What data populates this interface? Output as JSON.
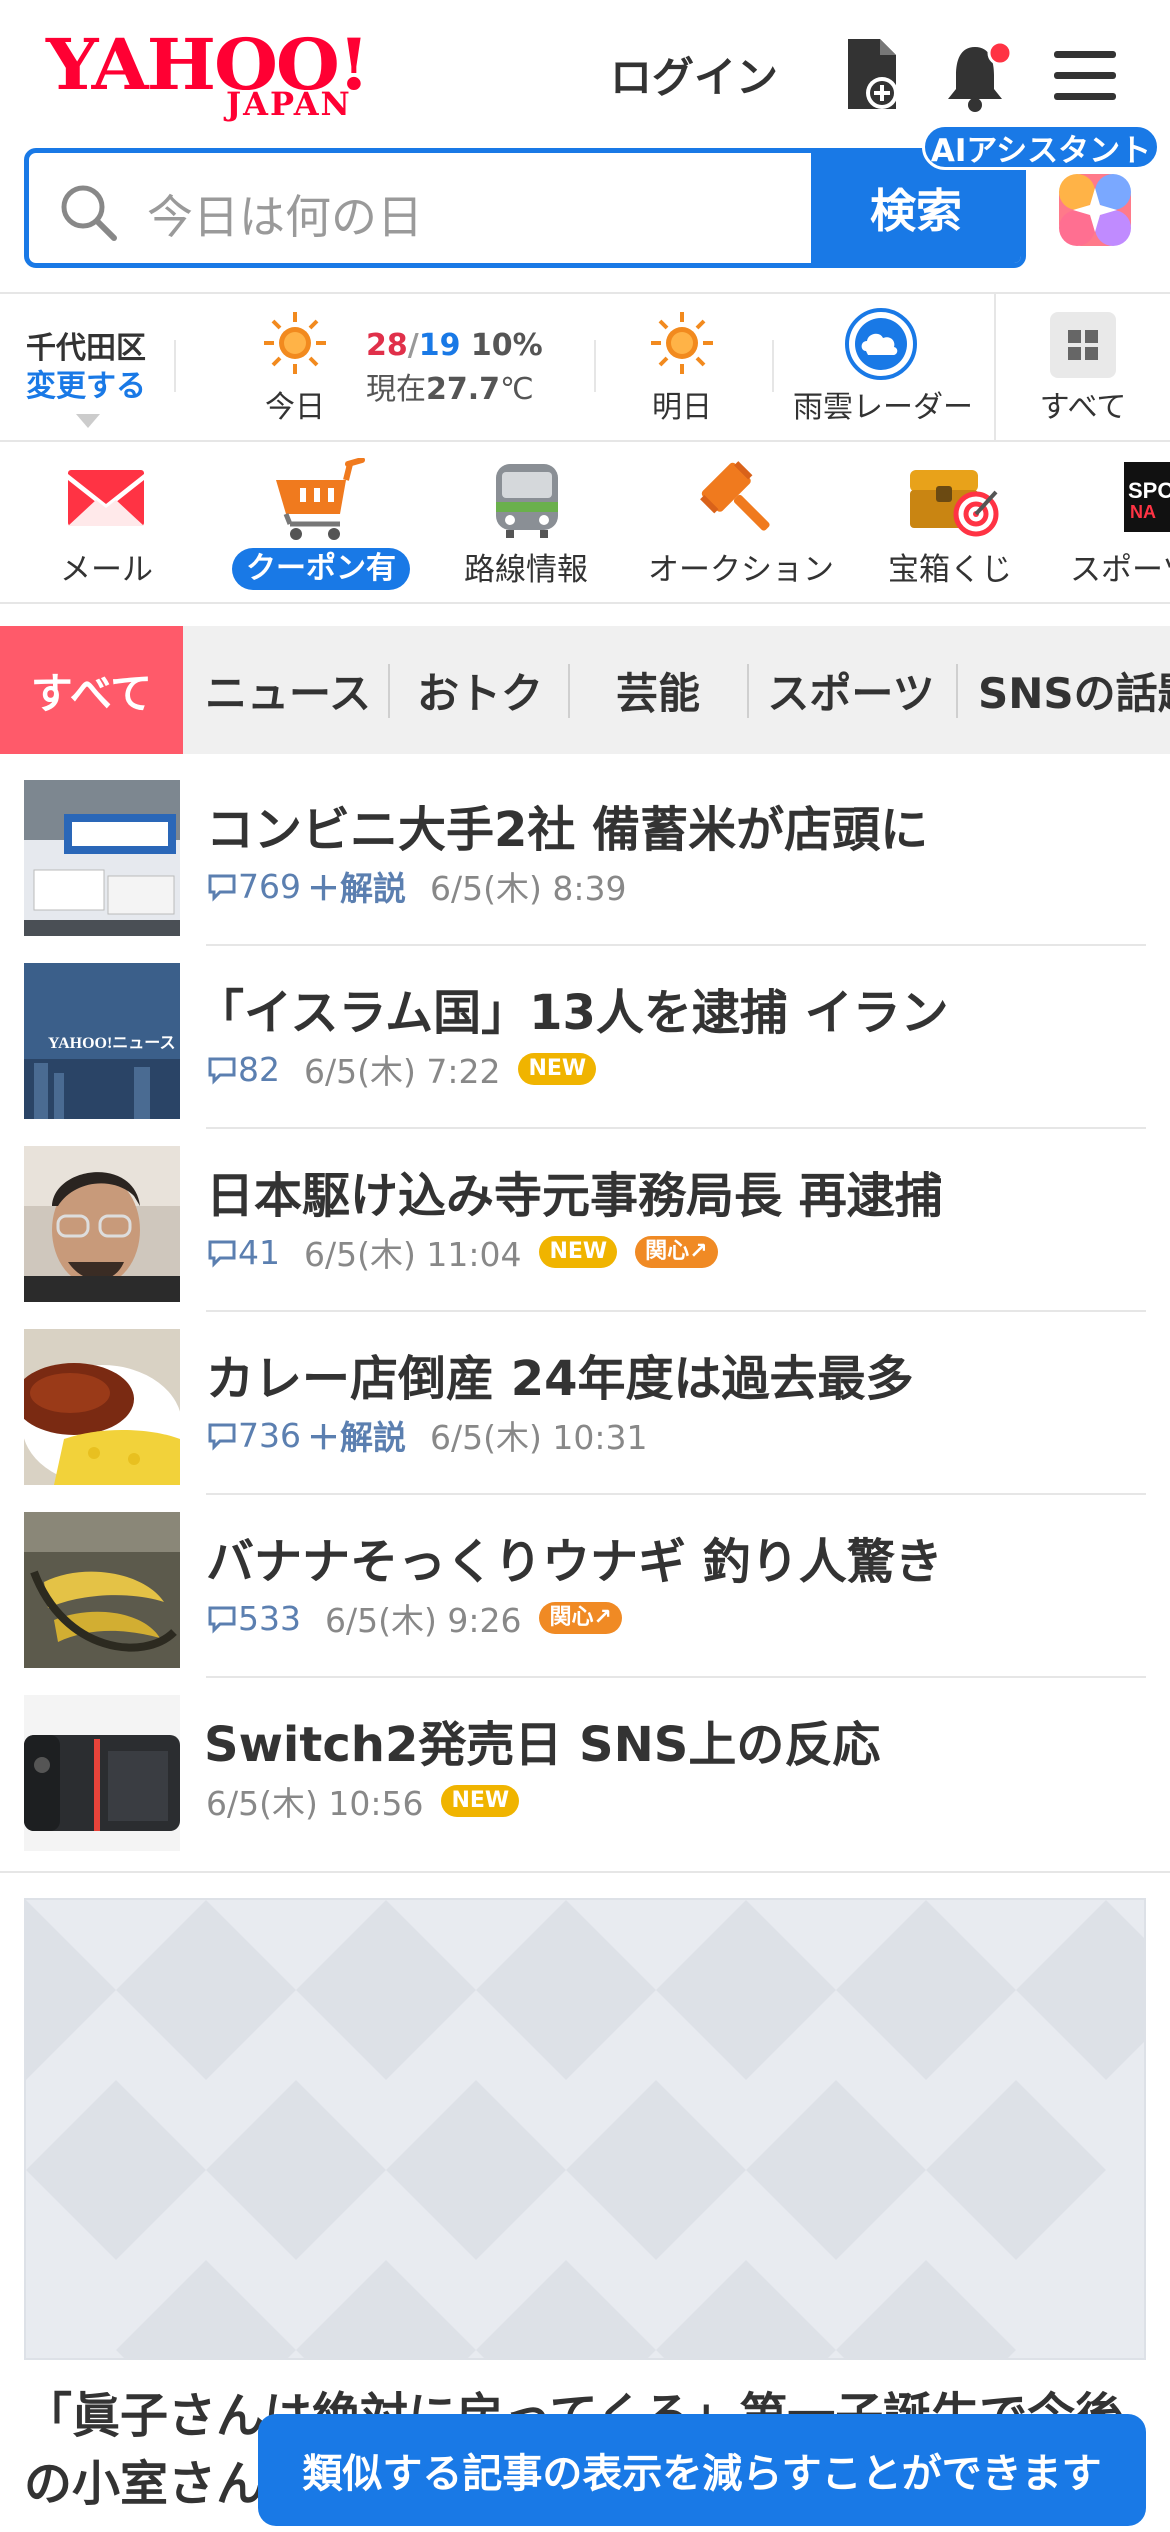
{
  "header": {
    "logo_text": "YAHOO!",
    "logo_sub": "JAPAN",
    "login_label": "ログイン",
    "icons": [
      "add-document-icon",
      "bell-icon",
      "hamburger-menu-icon"
    ]
  },
  "search": {
    "placeholder": "今日は何の日",
    "button_label": "検索",
    "ai_badge": "AIアシスタント"
  },
  "weather": {
    "location": "千代田区",
    "change_label": "変更する",
    "today_label": "今日",
    "high": "28",
    "slash": "/",
    "low": "19",
    "precip": "10%",
    "current_prefix": "現在",
    "current_temp": "27.7",
    "current_unit": "℃",
    "tomorrow_label": "明日",
    "radar_label": "雨雲レーダー",
    "all_label": "すべて"
  },
  "services": [
    {
      "label": "メール",
      "icon": "mail-icon"
    },
    {
      "label": "クーポン有",
      "icon": "shopping-cart-icon"
    },
    {
      "label": "路線情報",
      "icon": "train-icon"
    },
    {
      "label": "オークション",
      "icon": "auction-hammer-icon"
    },
    {
      "label": "宝箱くじ",
      "icon": "treasure-box-icon"
    },
    {
      "label": "スポーツ",
      "icon": "sports-icon"
    }
  ],
  "tabs": [
    "すべて",
    "ニュース",
    "おトク",
    "芸能",
    "スポーツ",
    "SNSの話題"
  ],
  "news": [
    {
      "title": "コンビニ大手2社 備蓄米が店頭に",
      "comments": "769",
      "plus": "＋",
      "kaisetsu": "解説",
      "date": "6/5(木) 8:39"
    },
    {
      "title": "「イスラム国」13人を逮捕 イラン",
      "comments": "82",
      "date": "6/5(木) 7:22",
      "badge": "NEW"
    },
    {
      "title": "日本駆け込み寺元事務局長 再逮捕",
      "comments": "41",
      "date": "6/5(木) 11:04",
      "badge": "NEW",
      "badge2": "関心"
    },
    {
      "title": "カレー店倒産 24年度は過去最多",
      "comments": "736",
      "plus": "＋",
      "kaisetsu": "解説",
      "date": "6/5(木) 10:31"
    },
    {
      "title": "バナナそっくりウナギ 釣り人驚き",
      "comments": "533",
      "date": "6/5(木) 9:26",
      "badge2": "関心"
    },
    {
      "title": "Switch2発売日 SNS上の反応",
      "date": "6/5(木) 10:56",
      "badge": "NEW"
    }
  ],
  "thumb_logo": "YAHOO!ニュース",
  "feature": {
    "title": "「眞子さんは絶対に戻ってくる」第一子誕生で今後の小室さん"
  },
  "toast": "類似する記事の表示を減らすことができます",
  "colors": {
    "brand": "#ff0033",
    "accent": "#1979e6",
    "tab_active": "#ff5a6a",
    "high_temp": "#e0304a",
    "new_badge": "#f0b400",
    "kanshin_badge": "#f08a24"
  }
}
